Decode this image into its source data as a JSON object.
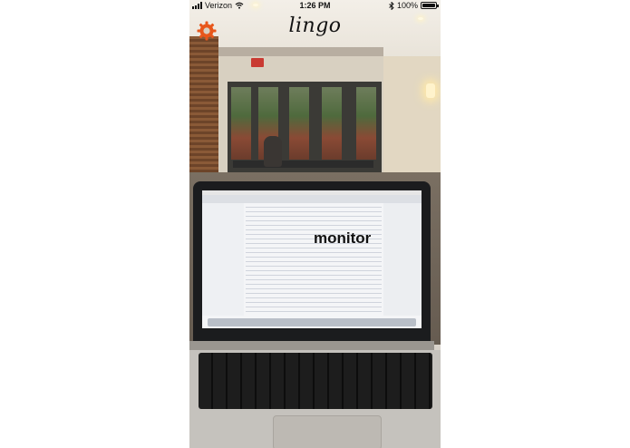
{
  "status_bar": {
    "carrier": "Verizon",
    "time": "1:26 PM",
    "battery_percent": "100%",
    "battery_level": 1.0,
    "icons": [
      "cellular-signal-icon",
      "wifi-icon",
      "bluetooth-icon",
      "battery-icon"
    ]
  },
  "app": {
    "title": "lingo",
    "settings_icon": "gear-icon",
    "accent_color": "#e8571b"
  },
  "detection": {
    "label": "monitor"
  }
}
